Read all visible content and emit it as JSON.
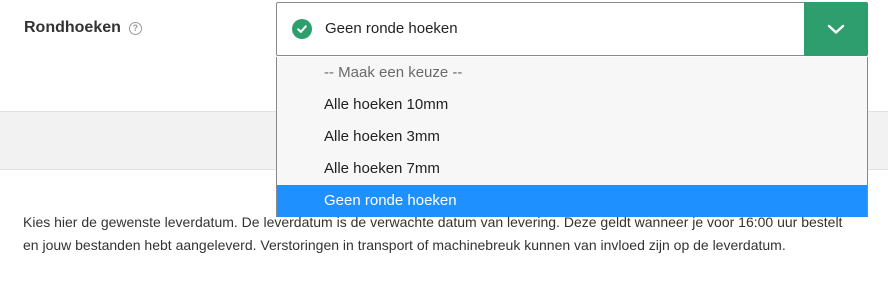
{
  "field": {
    "label": "Rondhoeken",
    "help_icon": "question-circle-icon",
    "help_glyph": "?"
  },
  "select": {
    "value": "Geen ronde hoeken",
    "status_icon": "check-circle-icon",
    "toggle_icon": "chevron-down-icon",
    "options": [
      "-- Maak een keuze --",
      "Alle hoeken 10mm",
      "Alle hoeken 3mm",
      "Alle hoeken 7mm",
      "Geen ronde hoeken"
    ],
    "selected_index": 4
  },
  "delivery": {
    "text": "Kies hier de gewenste leverdatum. De leverdatum is de verwachte datum van levering. Deze geldt wanneer je voor 16:00 uur bestelt en jouw bestanden hebt aangeleverd. Verstoringen in transport of machinebreuk kunnen van invloed zijn op de leverdatum."
  },
  "colors": {
    "accent": "#2f9e6e",
    "highlight": "#1e90ff"
  }
}
